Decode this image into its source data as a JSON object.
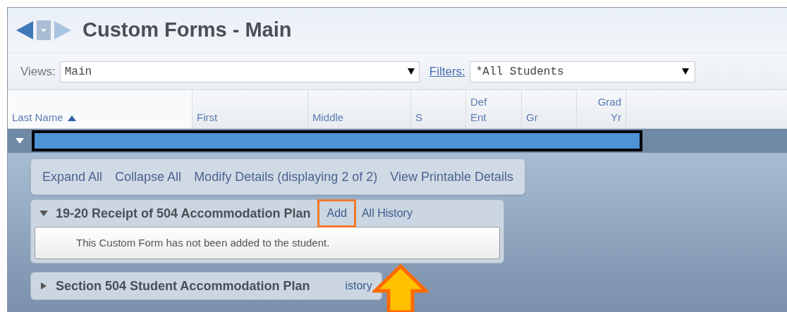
{
  "page_title": "Custom Forms - Main",
  "views": {
    "label": "Views:",
    "value": "Main"
  },
  "filters": {
    "label": "Filters:",
    "value": "*All Students"
  },
  "columns": [
    {
      "label": "Last Name",
      "sorted": true
    },
    {
      "label": "First",
      "sorted": false
    },
    {
      "label": "Middle",
      "sorted": false
    },
    {
      "label": "S",
      "sorted": false
    },
    {
      "label": "Def Ent",
      "sorted": false
    },
    {
      "label": "Gr",
      "sorted": false
    },
    {
      "label": "Grad Yr",
      "sorted": false
    }
  ],
  "student_row": {
    "expanded": true
  },
  "detail_links": [
    "Expand All",
    "Collapse All",
    "Modify Details (displaying 2 of 2)",
    "View Printable Details"
  ],
  "sections": [
    {
      "title": "19-20 Receipt of 504 Accommodation Plan",
      "expanded": true,
      "actions": [
        {
          "label": "Add",
          "highlighted": true
        },
        {
          "label": "All History",
          "highlighted": false
        }
      ],
      "message": "This Custom Form has not been added to the student."
    },
    {
      "title": "Section 504 Student Accommodation Plan",
      "expanded": false,
      "actions": [
        {
          "label": "istory",
          "highlighted": false
        }
      ]
    }
  ],
  "annotation": {
    "kind": "arrow"
  }
}
